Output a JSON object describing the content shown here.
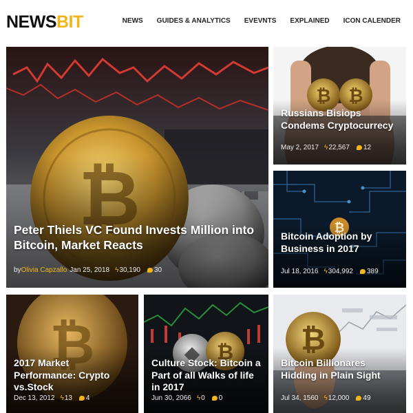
{
  "brand": {
    "part1": "NEWS",
    "part2": "BIT"
  },
  "nav": [
    "NEWS",
    "GUIDES & ANALYTICS",
    "EVEVNTS",
    "EXPLAINED",
    "ICON CALENDER"
  ],
  "colors": {
    "accent": "#f3b51c",
    "text_dark": "#111111"
  },
  "icons": {
    "views": "flash-icon",
    "comments": "comment-bubble-icon"
  },
  "articles": {
    "main": {
      "title": "Peter Thiels VC Found Invests Million into Bitcoin, Market Reacts",
      "by": "by",
      "author": "Olivia Capzallo",
      "date": "Jan 25, 2018",
      "views": "30,190",
      "comments": "30"
    },
    "r1": {
      "title": "Russians Bisiops Condems Cryptocurrecy",
      "date": "May 2, 2017",
      "views": "22,567",
      "comments": "12"
    },
    "r2": {
      "title": "Bitcoin Adoption by Business in 2017",
      "date": "Jul 18, 2016",
      "views": "304,992",
      "comments": "389"
    },
    "b1": {
      "title": "2017 Market Performance: Crypto vs.Stock",
      "date": "Dec 13, 2012",
      "views": "13",
      "comments": "4"
    },
    "b2": {
      "title": "Culture Stock: Bitcoin a Part of all Walks of life in 2017",
      "date": "Jun 30, 2066",
      "views": "0",
      "comments": "0"
    },
    "b3": {
      "title": "Bitcoin Billionares Hidding in Plain Sight",
      "date": "Jul 34, 1560",
      "views": "12,000",
      "comments": "49"
    }
  }
}
